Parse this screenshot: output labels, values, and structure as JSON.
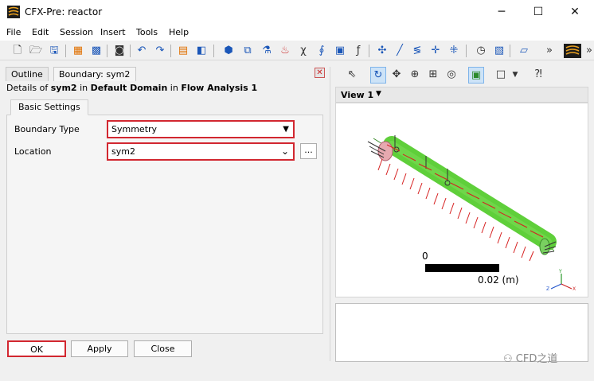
{
  "window": {
    "title": "CFX-Pre:  reactor",
    "minimize": "─",
    "maximize": "☐",
    "close": "✕"
  },
  "menu": [
    "File",
    "Edit",
    "Session",
    "Insert",
    "Tools",
    "Help"
  ],
  "toolbar_more": "»",
  "tabs": {
    "outline": "Outline",
    "boundary": "Boundary: sym2"
  },
  "panel_close_glyph": "✕",
  "details": {
    "prefix": "Details of ",
    "object": "sym2",
    "in1": " in ",
    "domain": "Default Domain",
    "in2": " in ",
    "analysis": "Flow Analysis 1"
  },
  "subtab": "Basic Settings",
  "fields": {
    "boundary_type_label": "Boundary Type",
    "boundary_type_value": "Symmetry",
    "location_label": "Location",
    "location_value": "sym2",
    "ellipsis": "..."
  },
  "buttons": {
    "ok": "OK",
    "apply": "Apply",
    "close": "Close"
  },
  "viewer": {
    "label": "View 1",
    "scale_zero": "0",
    "scale_value": "0.02  (m)"
  },
  "watermark": "CFD之道",
  "colors": {
    "highlight": "#d22730",
    "geometry": "#5fcf3a",
    "arrows": "#d62020"
  }
}
